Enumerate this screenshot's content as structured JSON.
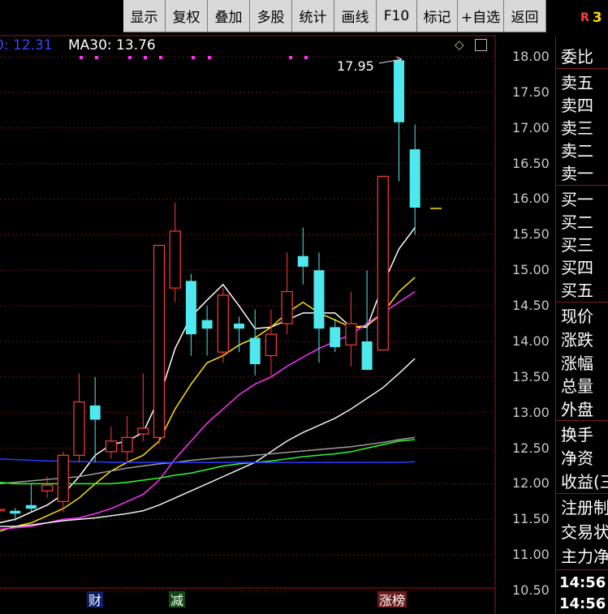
{
  "toolbar": {
    "items": [
      "显示",
      "复权",
      "叠加",
      "多股",
      "统计",
      "画线",
      "F10",
      "标记",
      "+自选",
      "返回"
    ],
    "flag_letter": "R",
    "flag_number": "3"
  },
  "indicators": {
    "ma_left": "0: 12.31",
    "ma30": "MA30: 13.76"
  },
  "chart": {
    "peak_label": "17.95",
    "badges": [
      "财",
      "减",
      "涨榜"
    ]
  },
  "price_axis": [
    "18.00",
    "17.50",
    "17.00",
    "16.50",
    "16.00",
    "15.50",
    "15.00",
    "14.50",
    "14.00",
    "13.50",
    "13.00",
    "12.50",
    "12.00",
    "11.50",
    "11.00",
    "10.50"
  ],
  "panel": {
    "weibi": "委比",
    "sell": [
      "卖五",
      "卖四",
      "卖三",
      "卖二",
      "卖一"
    ],
    "buy": [
      "买一",
      "买二",
      "买三",
      "买四",
      "买五"
    ],
    "quote": [
      "现价",
      "涨跌",
      "涨幅",
      "总量",
      "外盘"
    ],
    "fund": [
      "换手",
      "净资",
      "收益(三"
    ],
    "misc": [
      "注册制",
      "交易状",
      "主力净"
    ],
    "times": [
      "14:56",
      "14:56"
    ]
  },
  "chart_data": {
    "type": "candlestick",
    "title": "",
    "ylim": [
      10.3,
      18.2
    ],
    "y_ticks": [
      10.5,
      11.0,
      11.5,
      12.0,
      12.5,
      13.0,
      13.5,
      14.0,
      14.5,
      15.0,
      15.5,
      16.0,
      16.5,
      17.0,
      17.5,
      18.0
    ],
    "candles": [
      {
        "o": 11.62,
        "h": 11.7,
        "l": 11.58,
        "c": 11.64
      },
      {
        "o": 11.62,
        "h": 11.66,
        "l": 11.48,
        "c": 11.58
      },
      {
        "o": 11.7,
        "h": 12.0,
        "l": 11.6,
        "c": 11.65
      },
      {
        "o": 11.9,
        "h": 12.1,
        "l": 11.8,
        "c": 11.98
      },
      {
        "o": 11.75,
        "h": 12.45,
        "l": 11.6,
        "c": 12.4
      },
      {
        "o": 12.4,
        "h": 13.55,
        "l": 12.3,
        "c": 13.15
      },
      {
        "o": 13.1,
        "h": 13.5,
        "l": 12.3,
        "c": 12.9
      },
      {
        "o": 12.45,
        "h": 12.8,
        "l": 12.35,
        "c": 12.6
      },
      {
        "o": 12.45,
        "h": 12.95,
        "l": 12.3,
        "c": 12.65
      },
      {
        "o": 12.7,
        "h": 13.55,
        "l": 12.6,
        "c": 12.78
      },
      {
        "o": 12.65,
        "h": 15.35,
        "l": 12.55,
        "c": 15.35
      },
      {
        "o": 14.75,
        "h": 15.95,
        "l": 14.55,
        "c": 15.55
      },
      {
        "o": 14.85,
        "h": 14.95,
        "l": 13.8,
        "c": 14.1
      },
      {
        "o": 14.3,
        "h": 14.5,
        "l": 13.8,
        "c": 14.18
      },
      {
        "o": 13.85,
        "h": 14.75,
        "l": 13.7,
        "c": 14.65
      },
      {
        "o": 14.25,
        "h": 14.35,
        "l": 13.85,
        "c": 14.18
      },
      {
        "o": 14.05,
        "h": 14.45,
        "l": 13.52,
        "c": 13.68
      },
      {
        "o": 13.8,
        "h": 14.45,
        "l": 13.52,
        "c": 14.1
      },
      {
        "o": 14.25,
        "h": 15.25,
        "l": 14.1,
        "c": 14.7
      },
      {
        "o": 15.2,
        "h": 15.6,
        "l": 14.8,
        "c": 15.05
      },
      {
        "o": 15.0,
        "h": 15.25,
        "l": 13.7,
        "c": 14.18
      },
      {
        "o": 14.2,
        "h": 14.32,
        "l": 13.85,
        "c": 13.92
      },
      {
        "o": 13.95,
        "h": 14.7,
        "l": 13.65,
        "c": 14.25
      },
      {
        "o": 14.0,
        "h": 15.0,
        "l": 13.6,
        "c": 13.6
      },
      {
        "o": 13.88,
        "h": 16.3,
        "l": 13.88,
        "c": 16.32
      },
      {
        "o": 17.95,
        "h": 17.95,
        "l": 16.25,
        "c": 17.08
      },
      {
        "o": 16.7,
        "h": 17.05,
        "l": 15.5,
        "c": 15.88
      }
    ],
    "series": [
      {
        "color": "#ffffff",
        "values": [
          11.45,
          11.5,
          11.6,
          11.7,
          11.85,
          12.1,
          12.4,
          12.55,
          12.6,
          12.72,
          13.2,
          13.9,
          14.35,
          14.58,
          14.8,
          14.5,
          14.18,
          14.2,
          14.3,
          14.4,
          14.4,
          14.4,
          14.2,
          14.2,
          14.8,
          15.3,
          15.6
        ]
      },
      {
        "color": "#ffe000",
        "values": [
          11.33,
          11.4,
          11.45,
          11.55,
          11.65,
          11.8,
          12.0,
          12.18,
          12.3,
          12.4,
          12.6,
          13.05,
          13.4,
          13.7,
          13.8,
          13.95,
          14.05,
          14.2,
          14.4,
          14.55,
          14.4,
          14.3,
          14.2,
          14.22,
          14.4,
          14.7,
          14.9
        ]
      },
      {
        "color": "#ff33ff",
        "values": [
          11.36,
          11.38,
          11.4,
          11.45,
          11.5,
          11.52,
          11.58,
          11.65,
          11.75,
          11.85,
          12.05,
          12.35,
          12.6,
          12.85,
          13.05,
          13.25,
          13.4,
          13.5,
          13.65,
          13.78,
          13.9,
          14.0,
          14.1,
          14.25,
          14.4,
          14.55,
          14.7
        ]
      },
      {
        "color": "#f0f0f0",
        "values": [
          11.4,
          11.4,
          11.42,
          11.45,
          11.48,
          11.5,
          11.52,
          11.55,
          11.58,
          11.62,
          11.7,
          11.8,
          11.9,
          12.0,
          12.1,
          12.2,
          12.3,
          12.45,
          12.6,
          12.72,
          12.82,
          12.92,
          13.05,
          13.2,
          13.35,
          13.55,
          13.76
        ]
      },
      {
        "color": "#9a9a9a",
        "values": [
          12.0,
          12.02,
          12.04,
          12.06,
          12.08,
          12.1,
          12.14,
          12.18,
          12.22,
          12.25,
          12.28,
          12.3,
          12.33,
          12.35,
          12.37,
          12.38,
          12.4,
          12.42,
          12.44,
          12.46,
          12.48,
          12.5,
          12.52,
          12.55,
          12.58,
          12.62,
          12.65
        ]
      },
      {
        "color": "#2cff2c",
        "values": [
          12.02,
          12.0,
          12.0,
          12.0,
          12.0,
          12.0,
          12.0,
          12.0,
          12.02,
          12.05,
          12.08,
          12.12,
          12.15,
          12.2,
          12.25,
          12.28,
          12.3,
          12.32,
          12.35,
          12.38,
          12.4,
          12.42,
          12.45,
          12.5,
          12.55,
          12.6,
          12.62
        ]
      },
      {
        "color": "#2a3cff",
        "values": [
          12.35,
          12.34,
          12.33,
          12.32,
          12.32,
          12.31,
          12.31,
          12.3,
          12.3,
          12.3,
          12.3,
          12.3,
          12.3,
          12.3,
          12.3,
          12.3,
          12.3,
          12.3,
          12.3,
          12.3,
          12.3,
          12.3,
          12.3,
          12.3,
          12.3,
          12.3,
          12.31
        ]
      }
    ]
  }
}
